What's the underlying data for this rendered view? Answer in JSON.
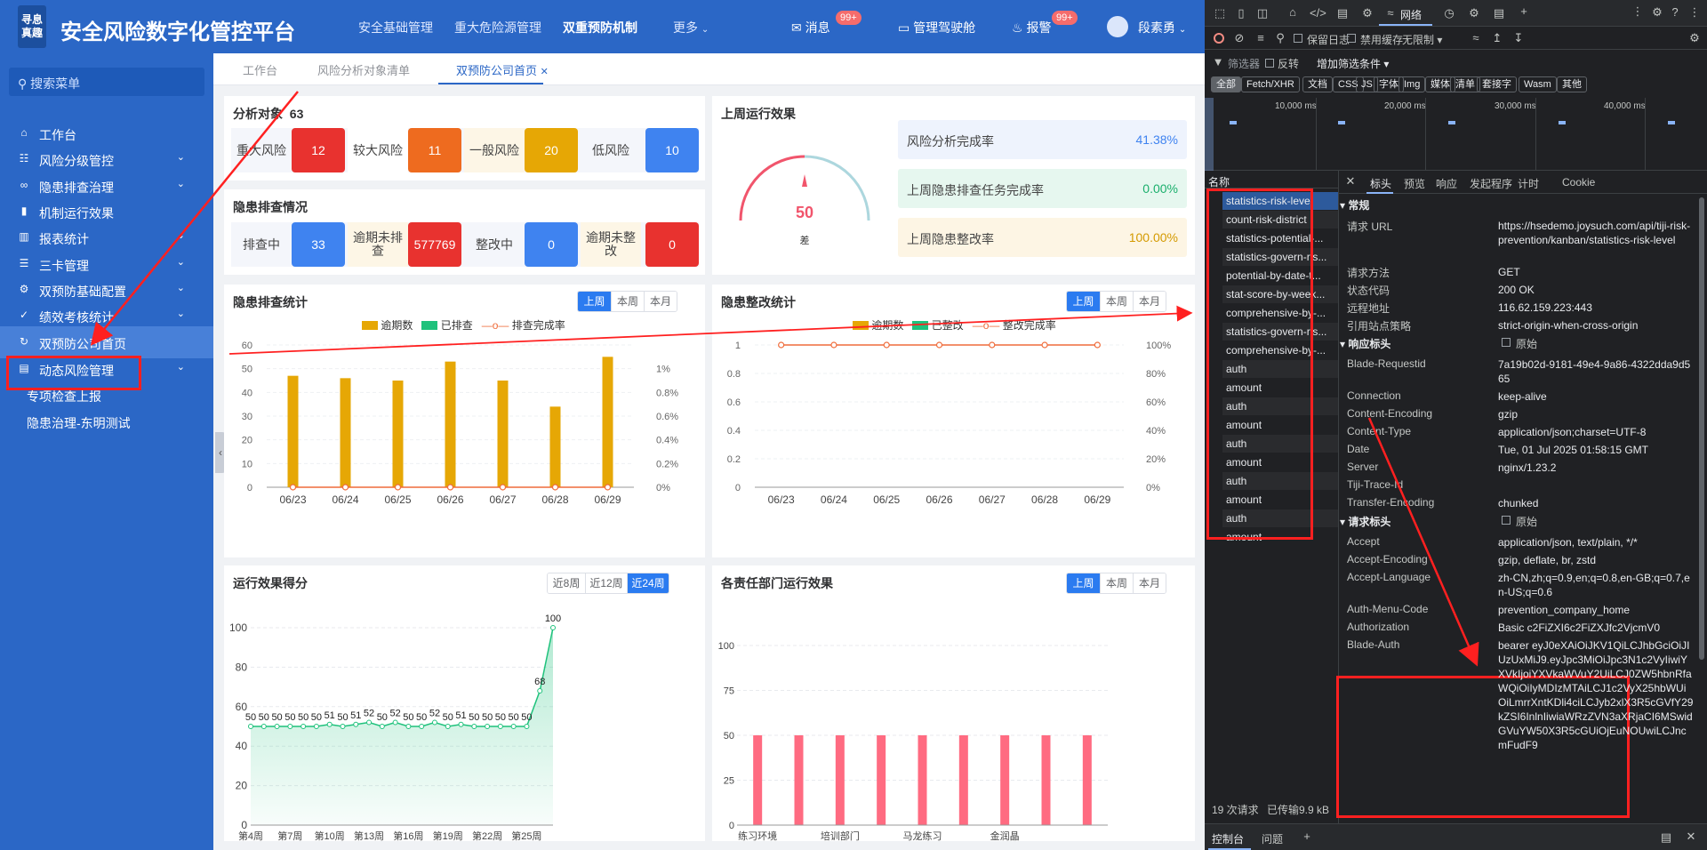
{
  "header": {
    "logo": "寻息\n真趣",
    "title": "安全风险数字化管控平台",
    "nav": [
      "安全基础管理",
      "重大危险源管理",
      "双重预防机制",
      "更多"
    ],
    "messages_label": "消息",
    "messages_badge": "99+",
    "cockpit_label": "管理驾驶舱",
    "alarm_label": "报警",
    "alarm_badge": "99+",
    "user_name": "段素勇"
  },
  "sidebar": {
    "search_placeholder": "搜索菜单",
    "items": [
      {
        "label": "工作台"
      },
      {
        "label": "风险分级管控"
      },
      {
        "label": "隐患排查治理"
      },
      {
        "label": "机制运行效果"
      },
      {
        "label": "报表统计"
      },
      {
        "label": "三卡管理"
      },
      {
        "label": "双预防基础配置"
      },
      {
        "label": "绩效考核统计"
      },
      {
        "label": "双预防公司首页"
      },
      {
        "label": "动态风险管理"
      },
      {
        "label": "专项检查上报"
      },
      {
        "label": "隐患治理-东明测试"
      }
    ]
  },
  "tabs": [
    "工作台",
    "风险分析对象清单",
    "双预防公司首页"
  ],
  "analysis": {
    "title": "分析对象",
    "count": "63",
    "levels": [
      {
        "label": "重大风险",
        "value": "12",
        "color": "#e8322f"
      },
      {
        "label": "较大风险",
        "value": "11",
        "color": "#ee6b1f"
      },
      {
        "label": "一般风险",
        "value": "20",
        "color": "#e6a705"
      },
      {
        "label": "低风险",
        "value": "10",
        "color": "#3f83f0"
      }
    ]
  },
  "hazard": {
    "title": "隐患排查情况",
    "items": [
      {
        "label": "排查中",
        "value": "33",
        "color": "#3f83f0"
      },
      {
        "label": "逾期未排查",
        "value": "577769",
        "color": "#e8322f"
      },
      {
        "label": "整改中",
        "value": "0",
        "color": "#3f83f0"
      },
      {
        "label": "逾期未整改",
        "value": "0",
        "color": "#e8322f"
      }
    ]
  },
  "lastweek": {
    "title": "上周运行效果",
    "gauge_value": "50",
    "gauge_label": "差",
    "rows": [
      {
        "label": "风险分析完成率",
        "value": "41.38%",
        "bg": "#eef3fd",
        "fg": "#3f83f0"
      },
      {
        "label": "上周隐患排查任务完成率",
        "value": "0.00%",
        "bg": "#e6f7ef",
        "fg": "#1aaf6c"
      },
      {
        "label": "上周隐患整改率",
        "value": "100.00%",
        "bg": "#fdf5e4",
        "fg": "#d49a00"
      }
    ]
  },
  "periods": [
    "上周",
    "本周",
    "本月"
  ],
  "score_periods": [
    "近8周",
    "近12周",
    "近24周"
  ],
  "chart_data": [
    {
      "type": "bar",
      "title": "隐患排查统计",
      "categories": [
        "06/23",
        "06/24",
        "06/25",
        "06/26",
        "06/27",
        "06/28",
        "06/29"
      ],
      "series": [
        {
          "name": "逾期数",
          "values": [
            47,
            46,
            45,
            53,
            45,
            34,
            55
          ],
          "color": "#e6a705"
        },
        {
          "name": "已排查",
          "values": [
            0,
            0,
            0,
            0,
            0,
            0,
            0
          ],
          "color": "#1fc27c"
        },
        {
          "name": "排查完成率",
          "type": "line",
          "values": [
            0,
            0,
            0,
            0,
            0,
            0,
            0
          ],
          "color": "#ef6c3b"
        }
      ],
      "ylim": [
        0,
        60
      ],
      "yticks": [
        0,
        10,
        20,
        30,
        40,
        50,
        60
      ],
      "y2ticks": [
        "0%",
        "0.2%",
        "0.4%",
        "0.6%",
        "0.8%",
        "1%"
      ]
    },
    {
      "type": "line",
      "title": "隐患整改统计",
      "categories": [
        "06/23",
        "06/24",
        "06/25",
        "06/26",
        "06/27",
        "06/28",
        "06/29"
      ],
      "series": [
        {
          "name": "逾期数",
          "values": [
            0,
            0,
            0,
            0,
            0,
            0,
            0
          ],
          "color": "#e6a705"
        },
        {
          "name": "已整改",
          "values": [
            0,
            0,
            0,
            0,
            0,
            0,
            0
          ],
          "color": "#1fc27c"
        },
        {
          "name": "整改完成率",
          "type": "line",
          "values": [
            1,
            1,
            1,
            1,
            1,
            1,
            1
          ],
          "color": "#ef6c3b"
        }
      ],
      "ylim": [
        0,
        1
      ],
      "yticks": [
        "0",
        "0.2",
        "0.4",
        "0.6",
        "0.8",
        "1"
      ],
      "y2ticks": [
        "0%",
        "20%",
        "40%",
        "60%",
        "80%",
        "100%"
      ]
    },
    {
      "type": "area",
      "title": "运行效果得分",
      "x": [
        "第4周",
        "",
        "",
        "第7周",
        "",
        "",
        "第10周",
        "",
        "",
        "第13周",
        "",
        "",
        "第16周",
        "",
        "",
        "第19周",
        "",
        "",
        "第22周",
        "",
        "",
        "第25周",
        "",
        ""
      ],
      "xticks": [
        "第4周",
        "第7周",
        "第10周",
        "第13周",
        "第16周",
        "第19周",
        "第22周",
        "第25周"
      ],
      "values": [
        50,
        50,
        50,
        50,
        50,
        50,
        51,
        50,
        51,
        52,
        50,
        52,
        50,
        50,
        52,
        50,
        51,
        50,
        50,
        50,
        50,
        50,
        68,
        100
      ],
      "ylim": [
        0,
        100
      ],
      "yticks": [
        0,
        20,
        40,
        60,
        80,
        100
      ],
      "color": "#1fc27c"
    },
    {
      "type": "bar",
      "title": "各责任部门运行效果",
      "categories": [
        "练习环境",
        "培训部门",
        "马龙练习",
        "金润晶",
        "",
        "",
        "",
        "",
        ""
      ],
      "xticks": [
        "练习环境",
        "培训部门",
        "马龙练习",
        "金润晶"
      ],
      "values": [
        50,
        50,
        50,
        50,
        50,
        50,
        50,
        50,
        50
      ],
      "ylim": [
        0,
        100
      ],
      "yticks": [
        0,
        25,
        50,
        75,
        100
      ],
      "color": "#ff6b81"
    }
  ],
  "devtools": {
    "tab_network": "网络",
    "filter_label": "筛选器",
    "invert": "反转",
    "more_filters": "增加筛选条件",
    "preserve_log": "保留日志",
    "disable_cache": "禁用缓存",
    "throttle": "无限制",
    "types": [
      "全部",
      "Fetch/XHR",
      "文档",
      "CSS",
      "JS",
      "字体",
      "Img",
      "媒体",
      "清单",
      "套接字",
      "Wasm",
      "其他"
    ],
    "timeline": [
      "10,000 ms",
      "20,000 ms",
      "30,000 ms",
      "40,000 ms"
    ],
    "name_col": "名称",
    "requests": [
      "statistics-risk-level",
      "count-risk-district",
      "statistics-potential-...",
      "statistics-govern-ris...",
      "potential-by-date-t...",
      "stat-score-by-week...",
      "comprehensive-by-...",
      "statistics-govern-ris...",
      "comprehensive-by-...",
      "auth",
      "amount",
      "auth",
      "amount",
      "auth",
      "amount",
      "auth",
      "amount",
      "auth",
      "amount"
    ],
    "detail_tabs": [
      "标头",
      "预览",
      "响应",
      "发起程序",
      "计时",
      "Cookie"
    ],
    "general_title": "常规",
    "general": [
      {
        "k": "请求 URL",
        "v": "https://hsedemo.joysuch.com/api/tiji-risk-prevention/kanban/statistics-risk-level"
      },
      {
        "k": "请求方法",
        "v": "GET"
      },
      {
        "k": "状态代码",
        "v": "200 OK"
      },
      {
        "k": "远程地址",
        "v": "116.62.159.223:443"
      },
      {
        "k": "引用站点策略",
        "v": "strict-origin-when-cross-origin"
      }
    ],
    "resp_title": "响应标头",
    "raw": "原始",
    "resp": [
      {
        "k": "Blade-Requestid",
        "v": "7a19b02d-9181-49e4-9a86-4322dda9d565"
      },
      {
        "k": "Connection",
        "v": "keep-alive"
      },
      {
        "k": "Content-Encoding",
        "v": "gzip"
      },
      {
        "k": "Content-Type",
        "v": "application/json;charset=UTF-8"
      },
      {
        "k": "Date",
        "v": "Tue, 01 Jul 2025 01:58:15 GMT"
      },
      {
        "k": "Server",
        "v": "nginx/1.23.2"
      },
      {
        "k": "Tiji-Trace-Id",
        "v": ""
      },
      {
        "k": "Transfer-Encoding",
        "v": "chunked"
      }
    ],
    "req_title": "请求标头",
    "reqh": [
      {
        "k": "Accept",
        "v": "application/json, text/plain, */*"
      },
      {
        "k": "Accept-Encoding",
        "v": "gzip, deflate, br, zstd"
      },
      {
        "k": "Accept-Language",
        "v": "zh-CN,zh;q=0.9,en;q=0.8,en-GB;q=0.7,en-US;q=0.6"
      },
      {
        "k": "Auth-Menu-Code",
        "v": "prevention_company_home"
      },
      {
        "k": "Authorization",
        "v": "Basic c2FiZXI6c2FiZXJfc2VjcmV0"
      },
      {
        "k": "Blade-Auth",
        "v": "bearer eyJ0eXAiOiJKV1QiLCJhbGciOiJIUzUxMiJ9.eyJpc3MiOiJpc3N1c2VyIiwiYXVkIjoiYXVkaWVuY2UiLCJ0ZW5hbnRfaWQiOiIyMDIzMTAiLCJ1c2VyX25hbWUiOiLmrrXntKDli4ciLCJyb2xlX3R5cGVfY29kZSI6InlnIiwiaWRzZVN3aXRjaCI6MSwidGVuYW50X3R5cGUiOjEuNOUwiLCJncmFudF9"
      }
    ],
    "status_requests": "19 次请求",
    "status_transfer": "已传输9.9 kB",
    "drawer": [
      "控制台",
      "问题"
    ]
  }
}
